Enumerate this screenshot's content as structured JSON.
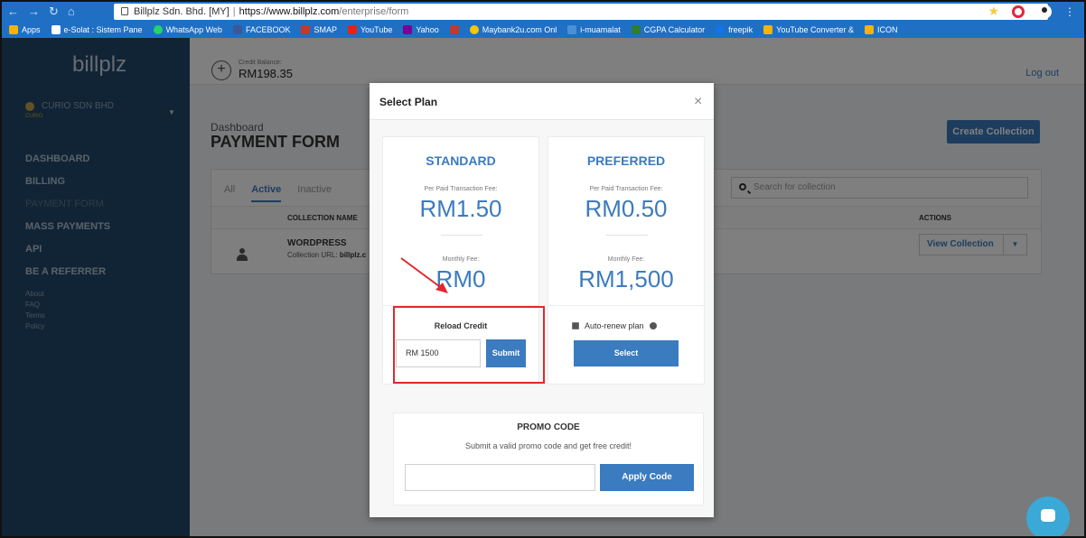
{
  "browser": {
    "tab_title": "Billplz Sdn. Bhd. [MY]",
    "url_host": "https://www.billplz.com",
    "url_path": "/enterprise/form",
    "bookmarks": [
      "Apps",
      "e-Solat : Sistem Pane",
      "WhatsApp Web",
      "FACEBOOK",
      "SMAP",
      "YouTube",
      "Yahoo",
      "",
      "Maybank2u.com Onl",
      "i-muamalat",
      "CGPA Calculator",
      "freepik",
      "YouTube Converter &",
      "ICON"
    ]
  },
  "sidebar": {
    "logo": "billplz",
    "company": "CURIO SDN BHD",
    "company_sub": "CURIO",
    "items": [
      {
        "label": "DASHBOARD"
      },
      {
        "label": "BILLING"
      },
      {
        "label": "PAYMENT FORM"
      },
      {
        "label": "MASS PAYMENTS"
      },
      {
        "label": "API"
      },
      {
        "label": "BE A REFERRER"
      }
    ],
    "footer_links": [
      "About",
      "FAQ",
      "Terms",
      "Policy"
    ]
  },
  "topbar": {
    "credit_label": "Credit Balance:",
    "credit_amount": "RM198.35",
    "logout": "Log out"
  },
  "main": {
    "breadcrumb": "Dashboard",
    "title": "PAYMENT FORM",
    "create_button": "Create Collection",
    "tabs": [
      "All",
      "Active",
      "Inactive"
    ],
    "search_placeholder": "Search for collection",
    "columns": [
      "COLLECTION NAME",
      "ACTIONS"
    ],
    "row": {
      "name": "WORDPRESS",
      "url_label": "Collection URL:",
      "url_value": "billplz.c",
      "view_button": "View Collection"
    }
  },
  "modal": {
    "title": "Select Plan",
    "close": "×",
    "plans": [
      {
        "name": "STANDARD",
        "fee_label": "Per Paid Transaction Fee:",
        "fee": "RM1.50",
        "monthly_label": "Monthly Fee:",
        "monthly": "RM0"
      },
      {
        "name": "PREFERRED",
        "fee_label": "Per Paid Transaction Fee:",
        "fee": "RM0.50",
        "monthly_label": "Monthly Fee:",
        "monthly": "RM1,500"
      }
    ],
    "reload": {
      "label": "Reload Credit",
      "value": "RM 1500",
      "submit": "Submit"
    },
    "preferred": {
      "autorenew": "Auto-renew plan",
      "select": "Select"
    },
    "promo": {
      "title": "PROMO CODE",
      "subtitle": "Submit a valid promo code and get free credit!",
      "button": "Apply Code"
    }
  },
  "colors": {
    "accent": "#3b7bbf",
    "sidebar": "#22486b",
    "highlight": "#e0282e",
    "browser": "#1f6fc5"
  }
}
